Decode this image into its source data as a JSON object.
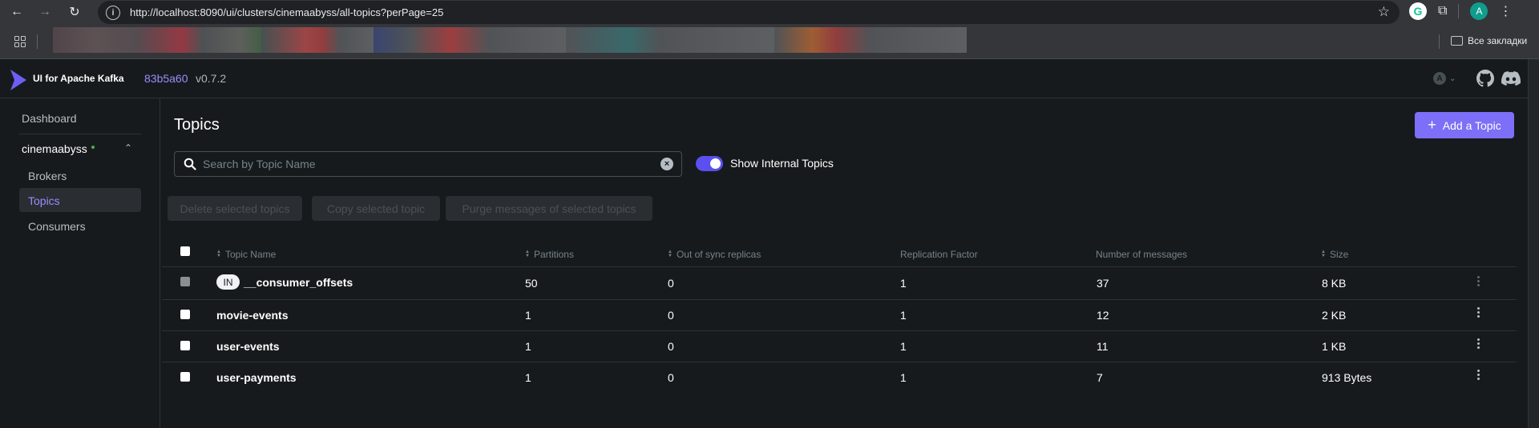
{
  "browser": {
    "url": "http://localhost:8090/ui/clusters/cinemaabyss/all-topics?perPage=25",
    "bookmarks_folder": "Все закладки",
    "profile_initial": "A",
    "extension_initial": "G",
    "info_icon": "i"
  },
  "header": {
    "app_title": "UI for Apache Kafka",
    "version_hash": "83b5a60",
    "version_number": "v0.7.2",
    "auth_initial": "A"
  },
  "sidebar": {
    "dashboard": "Dashboard",
    "cluster": "cinemaabyss",
    "items": [
      {
        "label": "Brokers"
      },
      {
        "label": "Topics"
      },
      {
        "label": "Consumers"
      }
    ]
  },
  "main": {
    "title": "Topics",
    "add_topic_label": "Add a Topic",
    "search_placeholder": "Search by Topic Name",
    "toggle_label": "Show Internal Topics",
    "toggle_on": true,
    "actions": [
      "Delete selected topics",
      "Copy selected topic",
      "Purge messages of selected topics"
    ]
  },
  "table": {
    "columns": [
      "Topic Name",
      "Partitions",
      "Out of sync replicas",
      "Replication Factor",
      "Number of messages",
      "Size"
    ],
    "internal_badge": "IN",
    "rows": [
      {
        "name": "__consumer_offsets",
        "internal": true,
        "partitions": "50",
        "out_of_sync": "0",
        "replication": "1",
        "messages": "37",
        "size": "8 KB"
      },
      {
        "name": "movie-events",
        "internal": false,
        "partitions": "1",
        "out_of_sync": "0",
        "replication": "1",
        "messages": "12",
        "size": "2 KB"
      },
      {
        "name": "user-events",
        "internal": false,
        "partitions": "1",
        "out_of_sync": "0",
        "replication": "1",
        "messages": "11",
        "size": "1 KB"
      },
      {
        "name": "user-payments",
        "internal": false,
        "partitions": "1",
        "out_of_sync": "0",
        "replication": "1",
        "messages": "7",
        "size": "913 Bytes"
      }
    ]
  },
  "colors": {
    "accent": "#7d6ff7",
    "background": "#171a1c",
    "status_online": "#4caf50"
  }
}
